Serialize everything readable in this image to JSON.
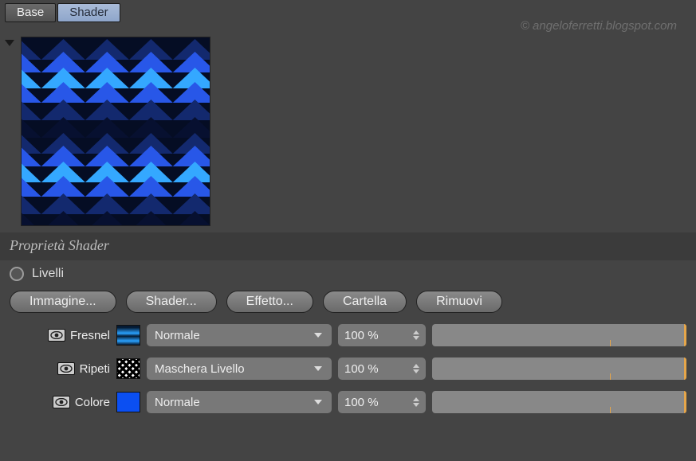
{
  "watermark": "© angeloferretti.blogspot.com",
  "tabs": {
    "base": "Base",
    "shader": "Shader"
  },
  "section_title": "Proprietà Shader",
  "livelli": {
    "label": "Livelli"
  },
  "buttons": {
    "immagine": "Immagine...",
    "shader": "Shader...",
    "effetto": "Effetto...",
    "cartella": "Cartella",
    "rimuovi": "Rimuovi"
  },
  "blend_modes": {
    "normale": "Normale",
    "maschera": "Maschera Livello"
  },
  "layers": [
    {
      "name": "Fresnel",
      "mode_key": "normale",
      "pct": "100 %"
    },
    {
      "name": "Ripeti",
      "mode_key": "maschera",
      "pct": "100 %"
    },
    {
      "name": "Colore",
      "mode_key": "normale",
      "pct": "100 %"
    }
  ],
  "swatch_colors": {
    "colore": "#0b4ff2"
  }
}
